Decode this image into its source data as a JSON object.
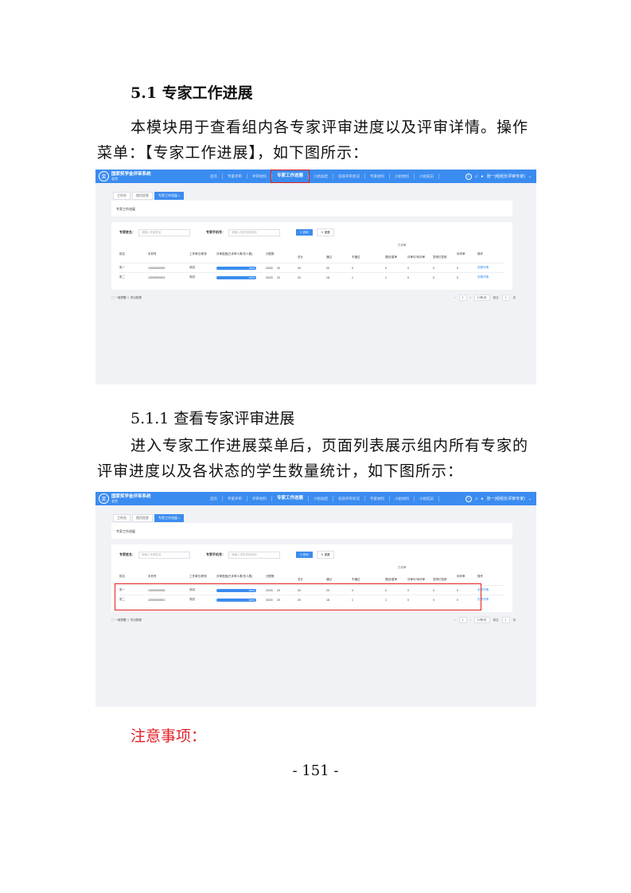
{
  "heading_5_1": "5.1 专家工作进展",
  "intro_paragraph": "本模块用于查看组内各专家评审进度以及评审详情。操作菜单：【专家工作进展】，如下图所示：",
  "heading_5_1_1": "5.1.1 查看专家评审进展",
  "detail_paragraph": "进入专家工作进展菜单后，页面列表展示组内所有专家的评审进度以及各状态的学生数量统计，如下图所示：",
  "notice_heading": "注意事项：",
  "page_number": "- 151 -",
  "colors": {
    "accent": "#3b8cf0",
    "highlight_red": "#e02020",
    "notice_red": "#e0202a"
  },
  "screenshots": [
    {
      "brand_title": "国家奖学金评审系统",
      "brand_sub": "北京",
      "nav": [
        "首页",
        "专家评审",
        "评审材料",
        "专家工作进展",
        "小组总结",
        "答辩评审状况",
        "专家材料",
        "小组材料",
        "小组成员"
      ],
      "nav_active_index": 3,
      "user": "张一(组组长评审专家)",
      "tabs": [
        "工作台",
        "首页信息",
        "专家工作进展 ×"
      ],
      "card_title": "专家工作进展",
      "search_name_label": "专家姓名：",
      "search_name_placeholder": "请输入专家姓名",
      "search_phone_label": "专家手机号：",
      "search_phone_placeholder": "请输入手机号码查询",
      "query_button": "查询",
      "reset_button": "重置",
      "group_header": "已评审",
      "columns": [
        "姓名",
        "手机号",
        "工作单位/职务",
        "评审进度(已评审人数/总人数)",
        "分配数",
        "总计",
        "通过",
        "不通过",
        "退回/重审",
        "评审中/待评审",
        "答辩已答辩",
        "待评审",
        "操作"
      ],
      "rows": [
        {
          "name": "张一",
          "phone": "10000000000",
          "org": "测试",
          "progress": "100%",
          "ratio": "20/20",
          "assigned": "20",
          "total": "20",
          "pass": "20",
          "fail": "0",
          "back": "0",
          "reviewing": "0",
          "defense": "0",
          "pending": "0",
          "action": "查看详情"
        },
        {
          "name": "张二",
          "phone": "10000000001",
          "org": "测试",
          "progress": "100%",
          "ratio": "20/20",
          "assigned": "20",
          "total": "20",
          "pass": "18",
          "fail": "1",
          "back": "1",
          "reviewing": "0",
          "defense": "0",
          "pending": "0",
          "action": "查看详情"
        }
      ],
      "pager_left": "◯ 一键提醒  ⇩ 导出数据",
      "pager_page": "1",
      "pager_size": "10条/页",
      "pager_goto_label": "前往",
      "pager_goto_value": "1",
      "pager_goto_unit": "页"
    }
  ]
}
